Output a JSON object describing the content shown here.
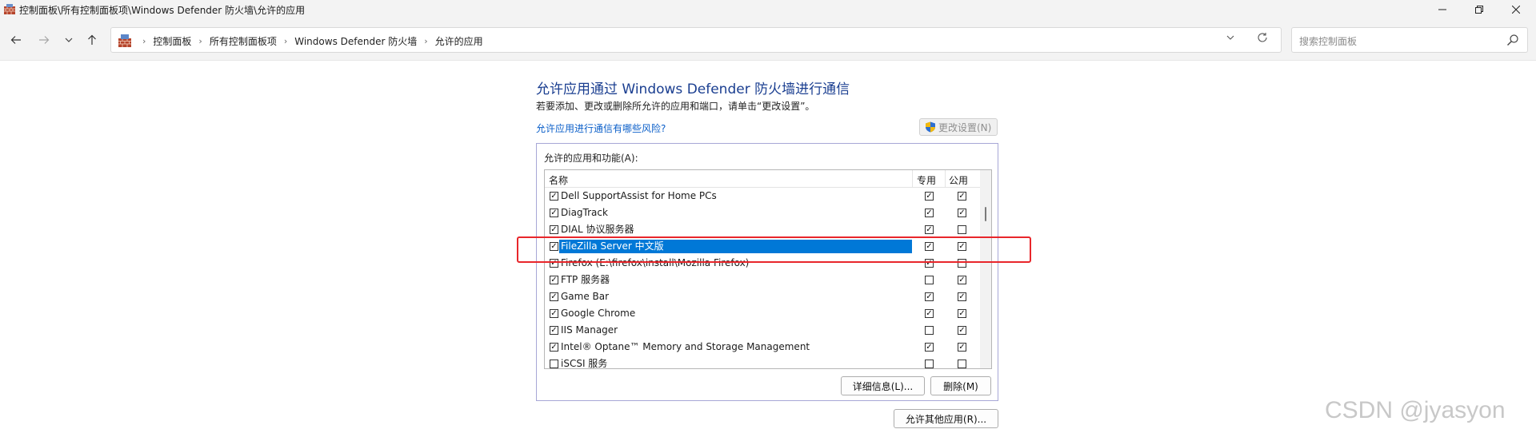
{
  "window": {
    "title": "控制面板\\所有控制面板项\\Windows Defender 防火墙\\允许的应用",
    "minimize_icon": "minimize-icon",
    "maximize_icon": "restore-icon",
    "close_icon": "close-icon"
  },
  "nav": {
    "back_icon": "arrow-left-icon",
    "forward_icon": "arrow-right-icon",
    "recent_icon": "chevron-down-icon",
    "up_icon": "arrow-up-icon"
  },
  "address": {
    "breadcrumbs": [
      "控制面板",
      "所有控制面板项",
      "Windows Defender 防火墙",
      "允许的应用"
    ],
    "dropdown_icon": "chevron-down-icon",
    "refresh_icon": "refresh-icon"
  },
  "search": {
    "placeholder": "搜索控制面板"
  },
  "main": {
    "heading": "允许应用通过 Windows Defender 防火墙进行通信",
    "subtext": "若要添加、更改或删除所允许的应用和端口，请单击“更改设置”。",
    "risk_link": "允许应用进行通信有哪些风险?",
    "change_settings": "更改设置(N)",
    "group_label": "允许的应用和功能(A):",
    "columns": {
      "name": "名称",
      "private": "专用",
      "public": "公用"
    },
    "apps": [
      {
        "name": "Dell SupportAssist for Home PCs",
        "enabled": true,
        "private": true,
        "public": true,
        "selected": false
      },
      {
        "name": "DiagTrack",
        "enabled": true,
        "private": true,
        "public": true,
        "selected": false
      },
      {
        "name": "DIAL 协议服务器",
        "enabled": true,
        "private": true,
        "public": false,
        "selected": false
      },
      {
        "name": "FileZilla Server 中文版",
        "enabled": true,
        "private": true,
        "public": true,
        "selected": true
      },
      {
        "name": "Firefox (E:\\firefox\\install\\Mozilla Firefox)",
        "enabled": true,
        "private": true,
        "public": false,
        "selected": false
      },
      {
        "name": "FTP 服务器",
        "enabled": true,
        "private": false,
        "public": true,
        "selected": false
      },
      {
        "name": "Game Bar",
        "enabled": true,
        "private": true,
        "public": true,
        "selected": false
      },
      {
        "name": "Google Chrome",
        "enabled": true,
        "private": true,
        "public": true,
        "selected": false
      },
      {
        "name": "IIS Manager",
        "enabled": true,
        "private": false,
        "public": true,
        "selected": false
      },
      {
        "name": "Intel® Optane™ Memory and Storage Management",
        "enabled": true,
        "private": true,
        "public": true,
        "selected": false
      },
      {
        "name": "iSCSI 服务",
        "enabled": false,
        "private": false,
        "public": false,
        "selected": false
      }
    ],
    "details_button": "详细信息(L)...",
    "remove_button": "删除(M)",
    "allow_other_button": "允许其他应用(R)..."
  },
  "watermark": "CSDN @jyasyon",
  "colors": {
    "heading": "#1a3e90",
    "link": "#0b5fc9",
    "selection": "#0078d7",
    "highlight": "#e8262b"
  }
}
